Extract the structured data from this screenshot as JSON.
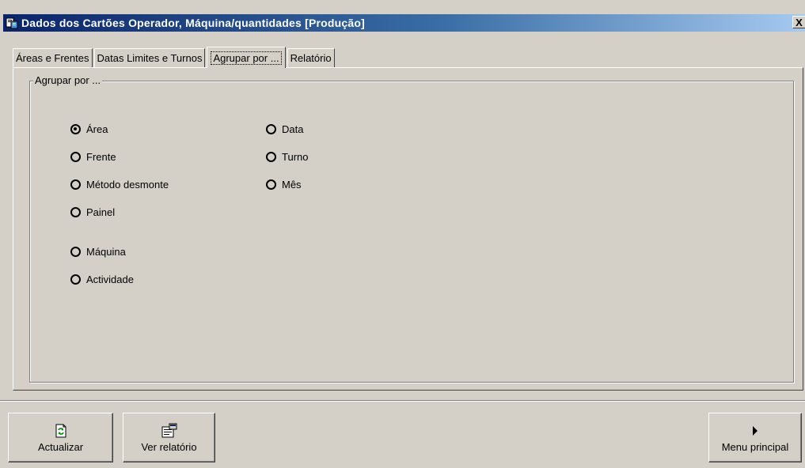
{
  "window": {
    "title": "Dados dos Cartões Operador, Máquina/quantidades [Produção]",
    "close_glyph": "X"
  },
  "tabs": [
    {
      "label": "Áreas e Frentes",
      "active": false
    },
    {
      "label": "Datas Limites e Turnos",
      "active": false
    },
    {
      "label": "Agrupar por ...",
      "active": true
    },
    {
      "label": "Relatório",
      "active": false
    }
  ],
  "group": {
    "legend": "Agrupar por ...",
    "left_options": [
      {
        "label": "Área",
        "checked": true
      },
      {
        "label": "Frente",
        "checked": false
      },
      {
        "label": "Método desmonte",
        "checked": false
      },
      {
        "label": "Painel",
        "checked": false
      },
      {
        "label": "Máquina",
        "checked": false
      },
      {
        "label": "Actividade",
        "checked": false
      }
    ],
    "right_options": [
      {
        "label": "Data",
        "checked": false
      },
      {
        "label": "Turno",
        "checked": false
      },
      {
        "label": "Mês",
        "checked": false
      }
    ]
  },
  "buttons": {
    "refresh": {
      "label": "Actualizar",
      "icon": "refresh-document-icon"
    },
    "view_report": {
      "label": "Ver relatório",
      "icon": "report-view-icon"
    },
    "main_menu": {
      "label": "Menu principal",
      "icon": "play-arrow-icon"
    }
  },
  "colors": {
    "face": "#d4d0c8",
    "title_start": "#0a246a",
    "title_end": "#a6caf0"
  }
}
